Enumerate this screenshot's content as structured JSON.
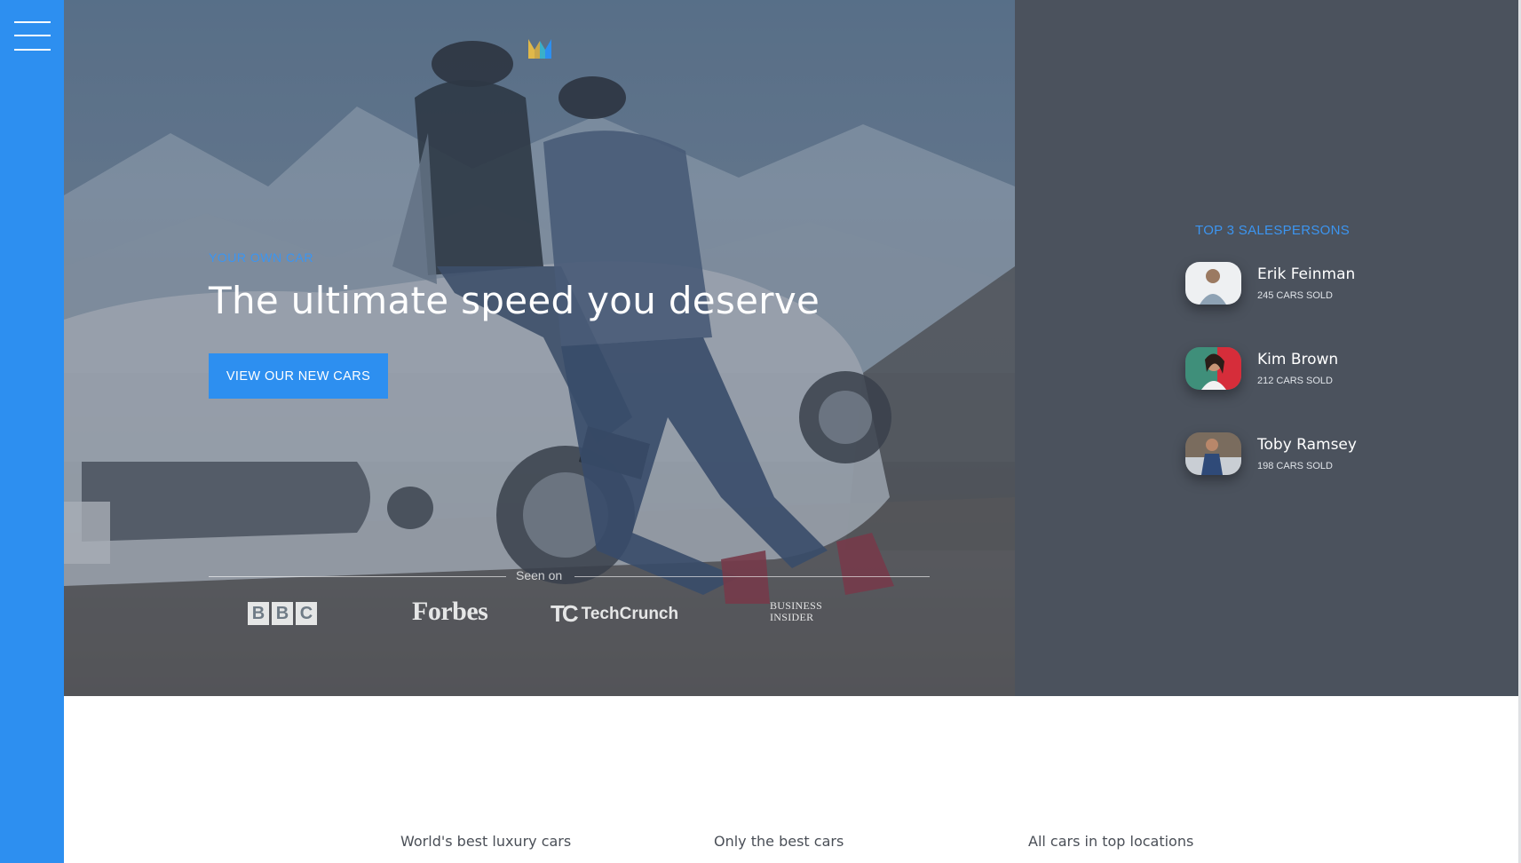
{
  "brand": {
    "logo_icon": "m-logo-icon"
  },
  "nav": {
    "menu_icon": "hamburger-icon"
  },
  "hero": {
    "eyebrow": "YOUR OWN CAR",
    "headline": "The ultimate speed you deserve",
    "cta_label": "VIEW OUR NEW CARS",
    "seen_on_label": "Seen on",
    "press": {
      "bbc": [
        "B",
        "B",
        "C"
      ],
      "forbes": "Forbes",
      "techcrunch_mark": "TC",
      "techcrunch": "TechCrunch",
      "business_insider_line1": "Business",
      "business_insider_line2": "Insider"
    }
  },
  "salespersons": {
    "title": "TOP 3 SALESPERSONS",
    "items": [
      {
        "name": "Erik Feinman",
        "sold": "245 CARS SOLD"
      },
      {
        "name": "Kim Brown",
        "sold": "212 CARS SOLD"
      },
      {
        "name": "Toby Ramsey",
        "sold": "198 CARS SOLD"
      }
    ]
  },
  "features": [
    {
      "label": "World's best luxury cars"
    },
    {
      "label": "Only the best cars"
    },
    {
      "label": "All cars in top locations"
    }
  ],
  "colors": {
    "accent": "#2d8ff0",
    "panel": "#4b525d",
    "eyebrow": "#3c95f0"
  }
}
